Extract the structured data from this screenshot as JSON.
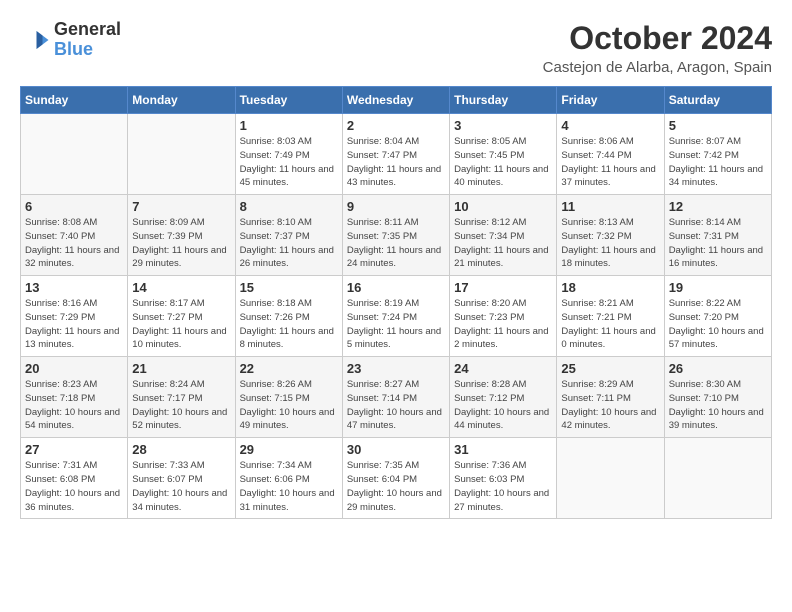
{
  "header": {
    "logo_line1": "General",
    "logo_line2": "Blue",
    "month": "October 2024",
    "location": "Castejon de Alarba, Aragon, Spain"
  },
  "weekdays": [
    "Sunday",
    "Monday",
    "Tuesday",
    "Wednesday",
    "Thursday",
    "Friday",
    "Saturday"
  ],
  "weeks": [
    [
      {
        "day": "",
        "info": ""
      },
      {
        "day": "",
        "info": ""
      },
      {
        "day": "1",
        "info": "Sunrise: 8:03 AM\nSunset: 7:49 PM\nDaylight: 11 hours and 45 minutes."
      },
      {
        "day": "2",
        "info": "Sunrise: 8:04 AM\nSunset: 7:47 PM\nDaylight: 11 hours and 43 minutes."
      },
      {
        "day": "3",
        "info": "Sunrise: 8:05 AM\nSunset: 7:45 PM\nDaylight: 11 hours and 40 minutes."
      },
      {
        "day": "4",
        "info": "Sunrise: 8:06 AM\nSunset: 7:44 PM\nDaylight: 11 hours and 37 minutes."
      },
      {
        "day": "5",
        "info": "Sunrise: 8:07 AM\nSunset: 7:42 PM\nDaylight: 11 hours and 34 minutes."
      }
    ],
    [
      {
        "day": "6",
        "info": "Sunrise: 8:08 AM\nSunset: 7:40 PM\nDaylight: 11 hours and 32 minutes."
      },
      {
        "day": "7",
        "info": "Sunrise: 8:09 AM\nSunset: 7:39 PM\nDaylight: 11 hours and 29 minutes."
      },
      {
        "day": "8",
        "info": "Sunrise: 8:10 AM\nSunset: 7:37 PM\nDaylight: 11 hours and 26 minutes."
      },
      {
        "day": "9",
        "info": "Sunrise: 8:11 AM\nSunset: 7:35 PM\nDaylight: 11 hours and 24 minutes."
      },
      {
        "day": "10",
        "info": "Sunrise: 8:12 AM\nSunset: 7:34 PM\nDaylight: 11 hours and 21 minutes."
      },
      {
        "day": "11",
        "info": "Sunrise: 8:13 AM\nSunset: 7:32 PM\nDaylight: 11 hours and 18 minutes."
      },
      {
        "day": "12",
        "info": "Sunrise: 8:14 AM\nSunset: 7:31 PM\nDaylight: 11 hours and 16 minutes."
      }
    ],
    [
      {
        "day": "13",
        "info": "Sunrise: 8:16 AM\nSunset: 7:29 PM\nDaylight: 11 hours and 13 minutes."
      },
      {
        "day": "14",
        "info": "Sunrise: 8:17 AM\nSunset: 7:27 PM\nDaylight: 11 hours and 10 minutes."
      },
      {
        "day": "15",
        "info": "Sunrise: 8:18 AM\nSunset: 7:26 PM\nDaylight: 11 hours and 8 minutes."
      },
      {
        "day": "16",
        "info": "Sunrise: 8:19 AM\nSunset: 7:24 PM\nDaylight: 11 hours and 5 minutes."
      },
      {
        "day": "17",
        "info": "Sunrise: 8:20 AM\nSunset: 7:23 PM\nDaylight: 11 hours and 2 minutes."
      },
      {
        "day": "18",
        "info": "Sunrise: 8:21 AM\nSunset: 7:21 PM\nDaylight: 11 hours and 0 minutes."
      },
      {
        "day": "19",
        "info": "Sunrise: 8:22 AM\nSunset: 7:20 PM\nDaylight: 10 hours and 57 minutes."
      }
    ],
    [
      {
        "day": "20",
        "info": "Sunrise: 8:23 AM\nSunset: 7:18 PM\nDaylight: 10 hours and 54 minutes."
      },
      {
        "day": "21",
        "info": "Sunrise: 8:24 AM\nSunset: 7:17 PM\nDaylight: 10 hours and 52 minutes."
      },
      {
        "day": "22",
        "info": "Sunrise: 8:26 AM\nSunset: 7:15 PM\nDaylight: 10 hours and 49 minutes."
      },
      {
        "day": "23",
        "info": "Sunrise: 8:27 AM\nSunset: 7:14 PM\nDaylight: 10 hours and 47 minutes."
      },
      {
        "day": "24",
        "info": "Sunrise: 8:28 AM\nSunset: 7:12 PM\nDaylight: 10 hours and 44 minutes."
      },
      {
        "day": "25",
        "info": "Sunrise: 8:29 AM\nSunset: 7:11 PM\nDaylight: 10 hours and 42 minutes."
      },
      {
        "day": "26",
        "info": "Sunrise: 8:30 AM\nSunset: 7:10 PM\nDaylight: 10 hours and 39 minutes."
      }
    ],
    [
      {
        "day": "27",
        "info": "Sunrise: 7:31 AM\nSunset: 6:08 PM\nDaylight: 10 hours and 36 minutes."
      },
      {
        "day": "28",
        "info": "Sunrise: 7:33 AM\nSunset: 6:07 PM\nDaylight: 10 hours and 34 minutes."
      },
      {
        "day": "29",
        "info": "Sunrise: 7:34 AM\nSunset: 6:06 PM\nDaylight: 10 hours and 31 minutes."
      },
      {
        "day": "30",
        "info": "Sunrise: 7:35 AM\nSunset: 6:04 PM\nDaylight: 10 hours and 29 minutes."
      },
      {
        "day": "31",
        "info": "Sunrise: 7:36 AM\nSunset: 6:03 PM\nDaylight: 10 hours and 27 minutes."
      },
      {
        "day": "",
        "info": ""
      },
      {
        "day": "",
        "info": ""
      }
    ]
  ]
}
